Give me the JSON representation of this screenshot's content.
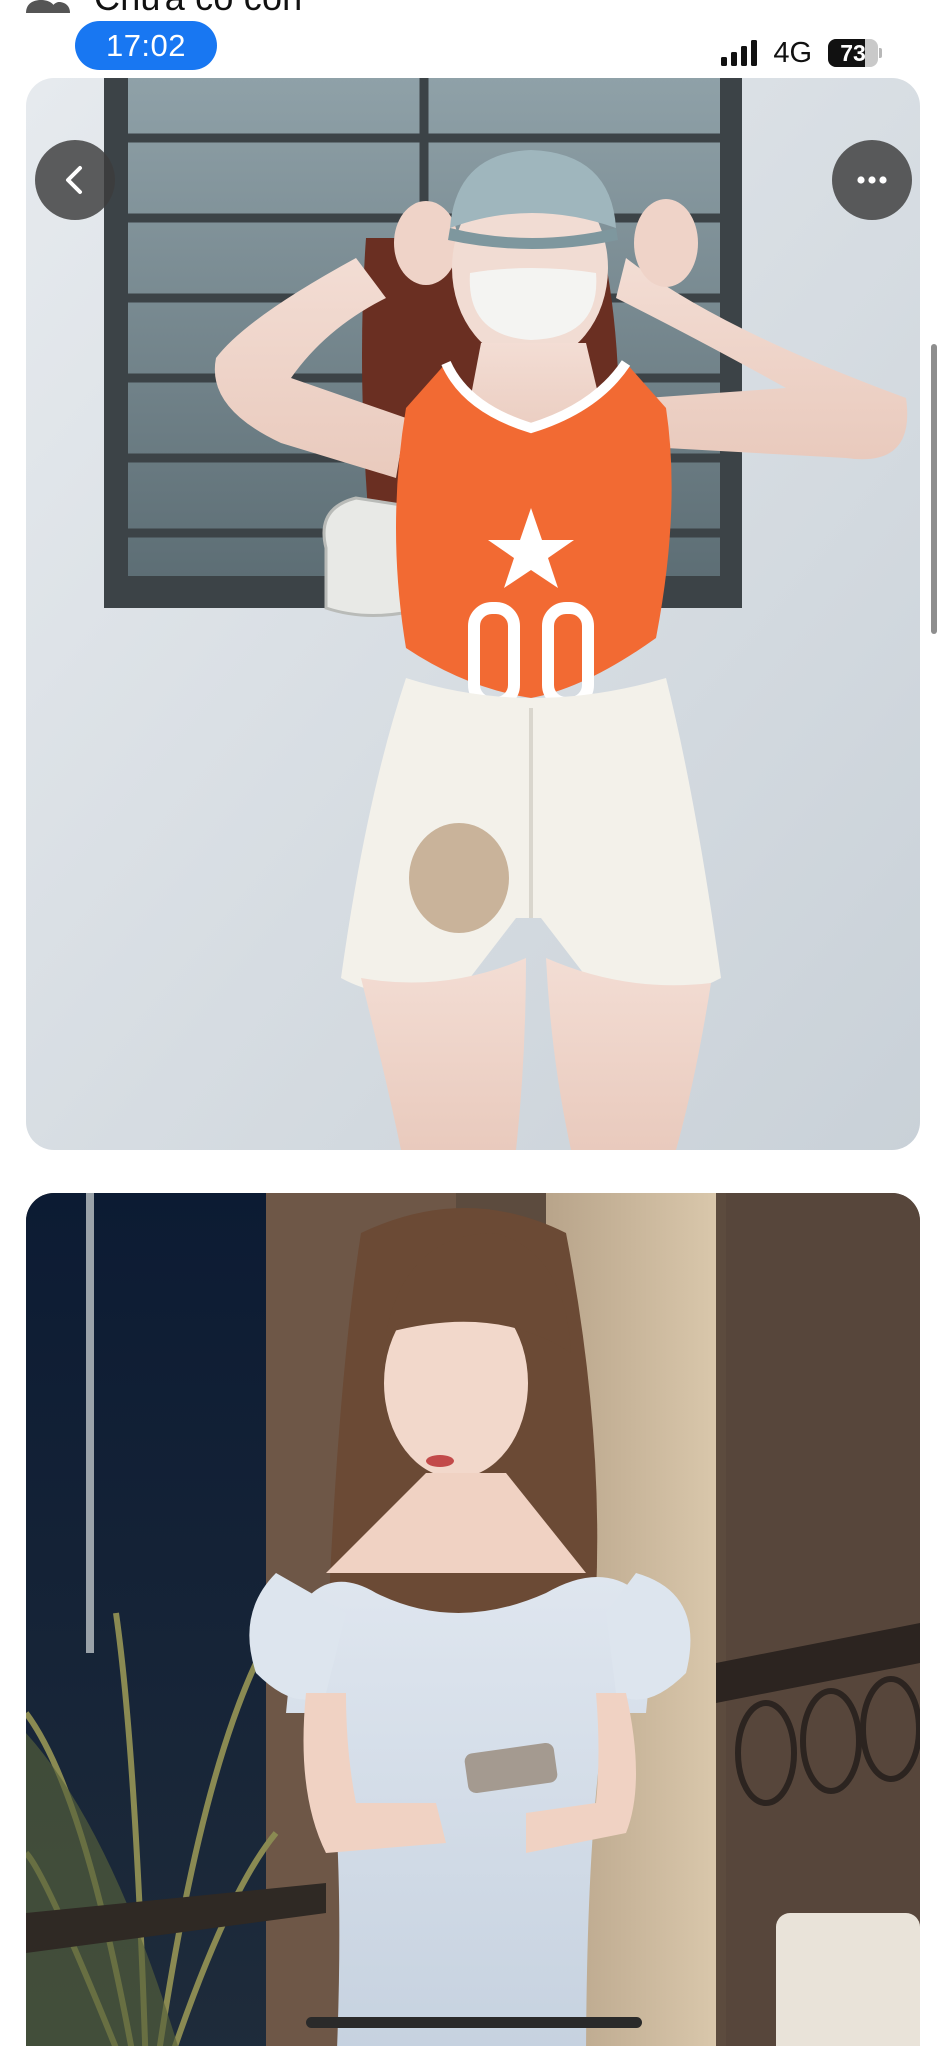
{
  "status_bar": {
    "peek_label": "Chưa có con",
    "peek_icon": "people-icon",
    "time": "17:02",
    "network": "4G",
    "battery_percent": "73",
    "battery_level": 0.73
  },
  "viewer": {
    "back_icon": "chevron-left-icon",
    "more_icon": "more-horizontal-icon"
  },
  "colors": {
    "time_pill": "#1877f2",
    "button_overlay": "#3c3c3c"
  }
}
